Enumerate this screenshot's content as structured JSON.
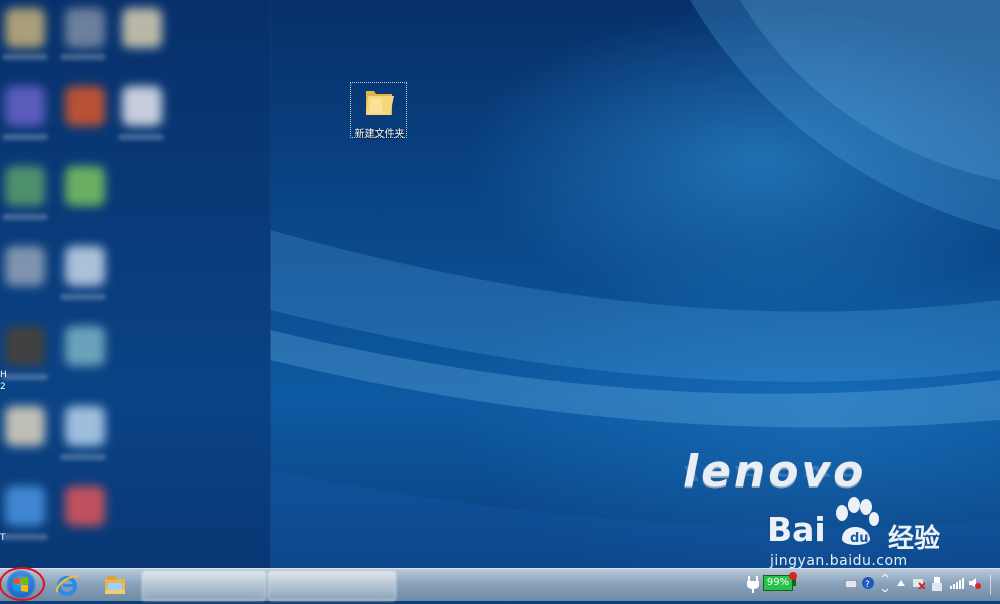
{
  "desktop": {
    "folder_label": "新建文件夹",
    "brand": "lenovo",
    "edge_chars": [
      "H",
      "2",
      "T"
    ]
  },
  "watermark": {
    "brand": "Bai",
    "brand_cn": "经验",
    "url": "jingyan.baidu.com"
  },
  "taskbar": {
    "battery_percent": "99%",
    "accent": "#e3101a"
  }
}
